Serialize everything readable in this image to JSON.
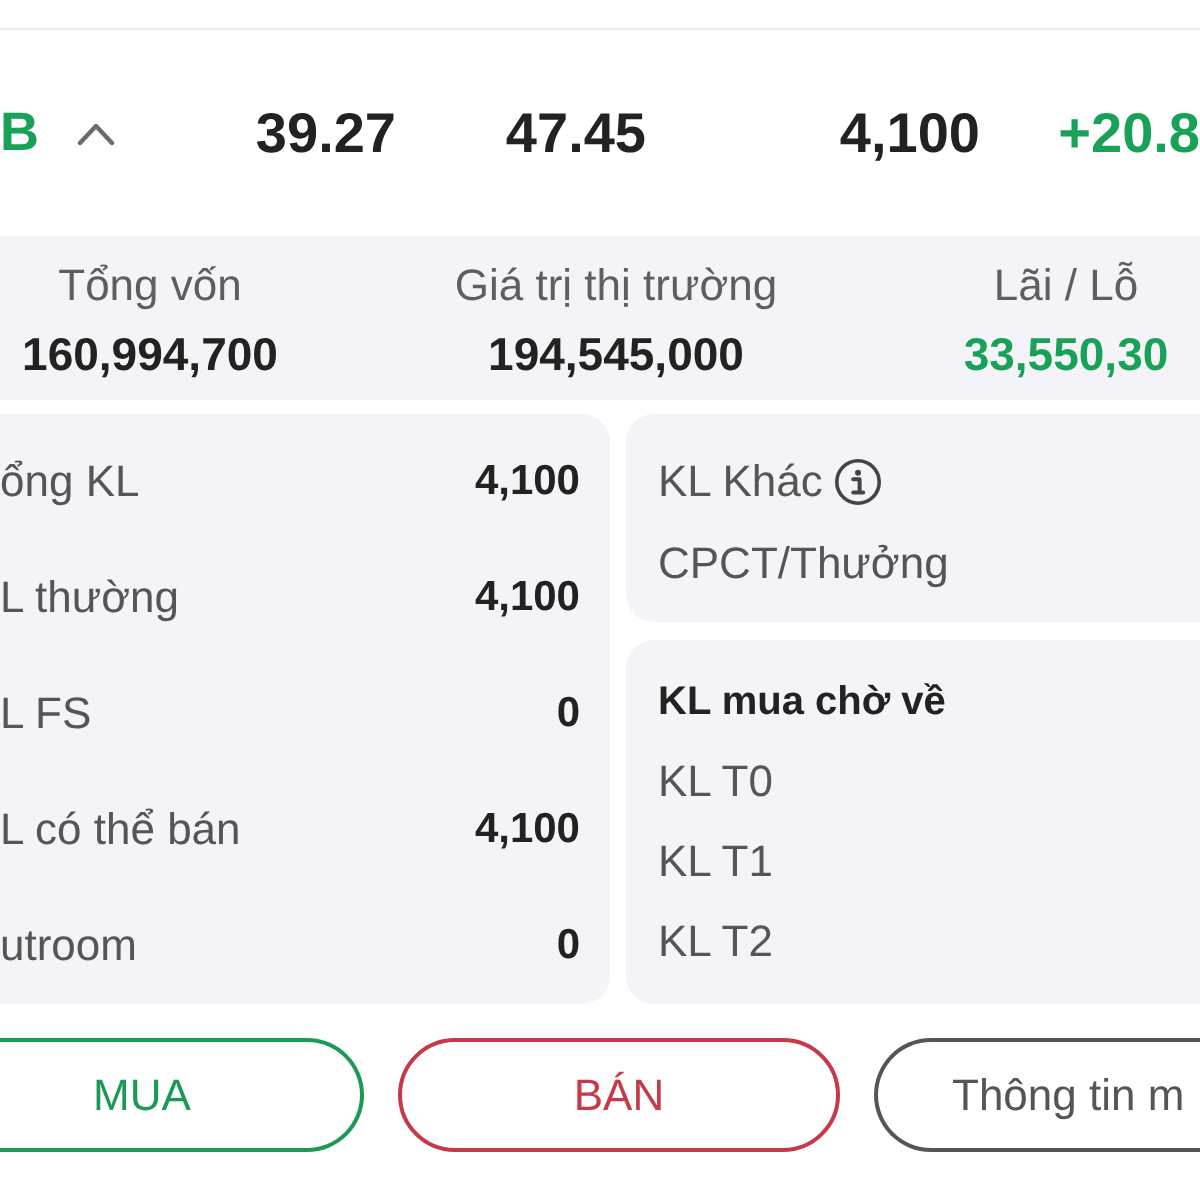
{
  "position_row": {
    "symbol": "B",
    "expanded": true,
    "cells": [
      "39.27",
      "47.45",
      "4,100"
    ],
    "change": "+20.8"
  },
  "summary": [
    {
      "label": "Tổng vốn",
      "value": "160,994,700",
      "positive": false
    },
    {
      "label": "Giá trị thị trường",
      "value": "194,545,000",
      "positive": false
    },
    {
      "label": "Lãi / Lỗ",
      "value": "33,550,30",
      "positive": true
    }
  ],
  "volume_card": {
    "rows": [
      {
        "label": "ổng KL",
        "value": "4,100"
      },
      {
        "label": "L thường",
        "value": "4,100"
      },
      {
        "label": "L FS",
        "value": "0"
      },
      {
        "label": "L có thể bán",
        "value": "4,100"
      },
      {
        "label": "utroom",
        "value": "0"
      }
    ]
  },
  "other_card": {
    "rows": [
      {
        "label": "KL Khác",
        "has_info": true
      },
      {
        "label": "CPCT/Thưởng",
        "has_info": false
      }
    ]
  },
  "pending_card": {
    "title": "KL mua chờ về",
    "rows": [
      "KL T0",
      "KL T1",
      "KL T2"
    ]
  },
  "buttons": [
    {
      "label": "MUA",
      "kind": "buy"
    },
    {
      "label": "BÁN",
      "kind": "sell"
    },
    {
      "label": "Thông tin m",
      "kind": "info"
    }
  ]
}
